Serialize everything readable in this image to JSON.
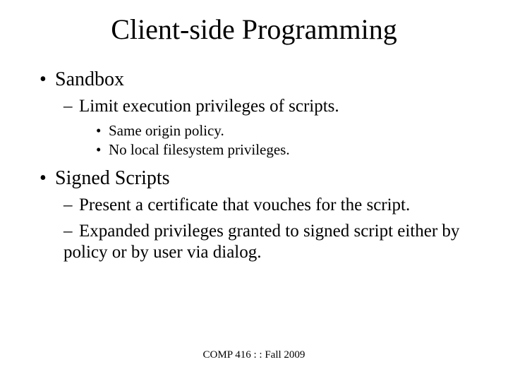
{
  "title": "Client-side Programming",
  "bullets": {
    "sandbox": {
      "label": "Sandbox",
      "limit": "Limit execution privileges of scripts.",
      "same_origin": "Same origin policy.",
      "no_fs": "No local filesystem privileges."
    },
    "signed": {
      "label": "Signed Scripts",
      "cert": "Present a certificate that vouches for the script.",
      "expanded": "Expanded privileges granted to signed script either by policy or by user via dialog."
    }
  },
  "footer": "COMP 416 : : Fall 2009",
  "glyphs": {
    "disc": "•",
    "endash": "–"
  }
}
